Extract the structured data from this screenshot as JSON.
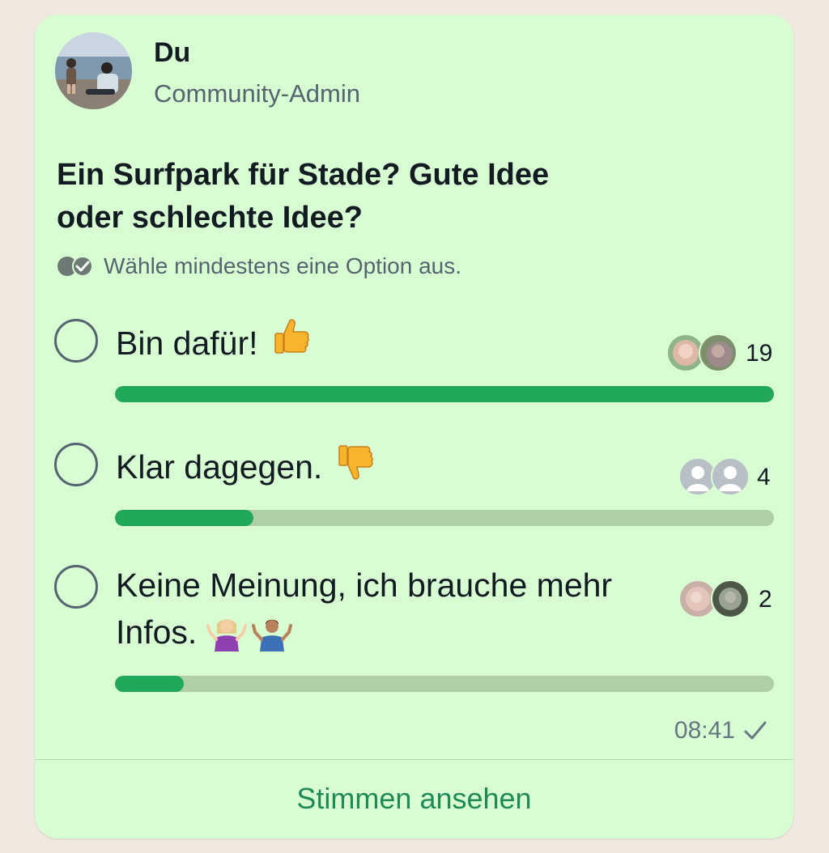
{
  "message": {
    "sender_name": "Du",
    "sender_role": "Community-Admin",
    "avatar_icon": "beach-photo-avatar"
  },
  "poll": {
    "question": "Ein Surfpark für Stade? Gute Idee oder schlechte Idee?",
    "hint": "Wähle mindestens eine Option aus.",
    "hint_icon": "double-check-icon",
    "options": [
      {
        "label": "Bin dafür!",
        "emoji": "thumbs-up-icon",
        "votes": "19",
        "fill_fraction": 1.0,
        "voter_icons": [
          "blurred-photo-avatar",
          "blurred-photo-avatar"
        ]
      },
      {
        "label": "Klar dagegen.",
        "emoji": "thumbs-down-icon",
        "votes": "4",
        "fill_fraction": 0.21,
        "voter_icons": [
          "default-person-avatar",
          "default-person-avatar"
        ]
      },
      {
        "label": "Keine Meinung, ich brauche mehr Infos.",
        "emoji": "shrug-icons",
        "votes": "2",
        "fill_fraction": 0.105,
        "voter_icons": [
          "blurred-photo-avatar",
          "blurred-photo-avatar"
        ]
      }
    ]
  },
  "footer": {
    "time": "08:41",
    "status_icon": "sent-check-icon",
    "view_votes_label": "Stimmen ansehen"
  },
  "colors": {
    "bubble": "#d9fdd3",
    "bar_fill": "#21a85a",
    "bar_track": "#aecfa8",
    "link": "#1f8a56"
  }
}
